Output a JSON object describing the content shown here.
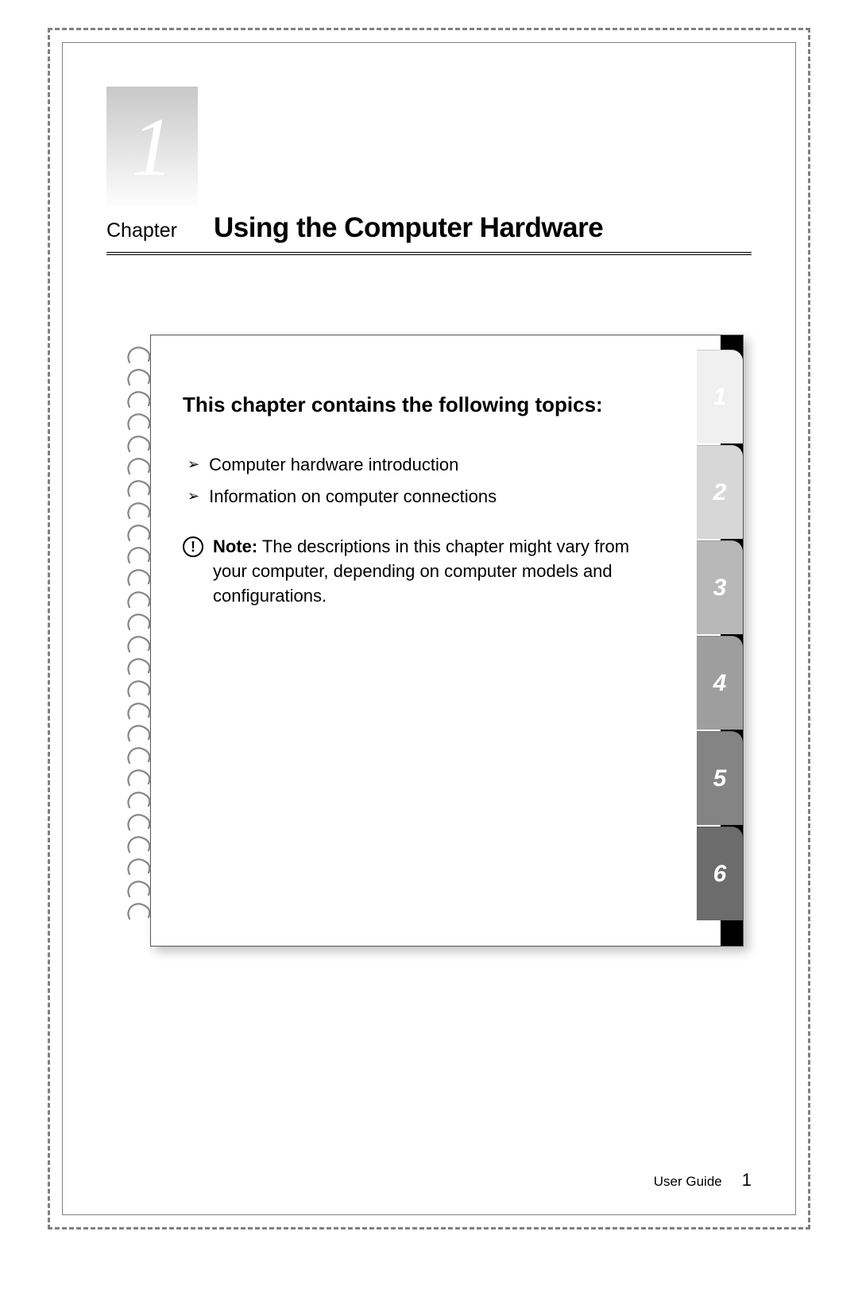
{
  "chapter": {
    "number_display": "1",
    "label": "Chapter",
    "title": "Using the Computer Hardware"
  },
  "topics": {
    "heading": "This chapter contains the following topics:",
    "items": [
      "Computer hardware introduction",
      "Information on computer connections"
    ]
  },
  "note": {
    "label": "Note:",
    "text": " The descriptions in this chapter might vary from your computer, depending on computer models and configurations."
  },
  "tabs": [
    {
      "num": "1",
      "color": "#f0f0f0"
    },
    {
      "num": "2",
      "color": "#d7d7d7"
    },
    {
      "num": "3",
      "color": "#b8b8b8"
    },
    {
      "num": "4",
      "color": "#9e9e9e"
    },
    {
      "num": "5",
      "color": "#848484"
    },
    {
      "num": "6",
      "color": "#6c6c6c"
    }
  ],
  "footer": {
    "guide": "User Guide",
    "page": "1"
  }
}
